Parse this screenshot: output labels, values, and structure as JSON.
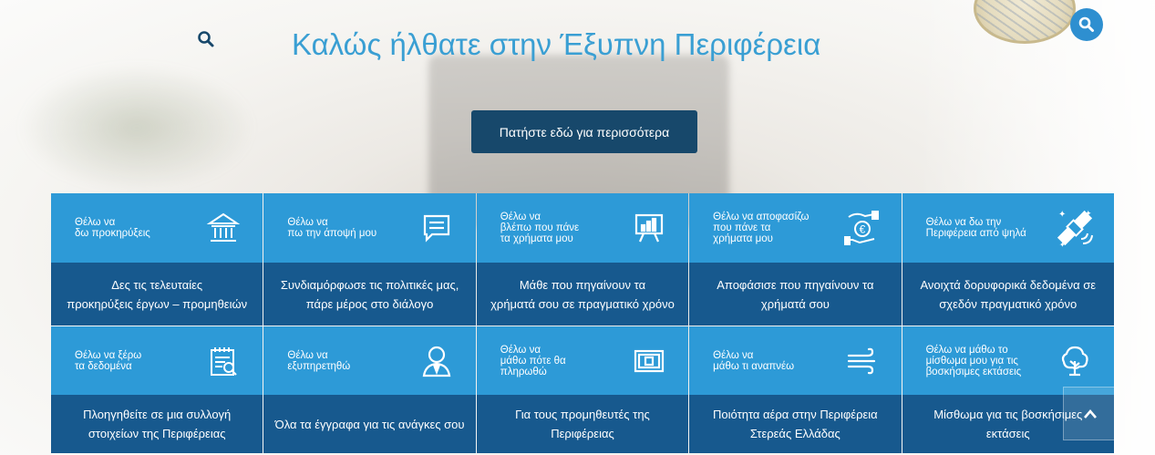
{
  "hero": {
    "title": "Καλώς ήλθατε στην Έξυπνη Περιφέρεια",
    "cta_label": "Πατήστε εδώ για περισσότερα"
  },
  "colors": {
    "title": "#3a9fd3",
    "cta_bg": "#17486b",
    "tile_top": "#2d9ad7",
    "tile_bottom": "#17598e"
  },
  "tiles_row1": [
    {
      "label": "Θέλω να\nδω προκηρύξεις",
      "desc": "Δες τις τελευταίες\nπροκηρύξεις έργων – προμηθειών",
      "icon": "bank-icon"
    },
    {
      "label": "Θέλω να\nπω την άποψή μου",
      "desc": "Συνδιαμόρφωσε τις πολιτικές μας,\nπάρε μέρος στο διάλογο",
      "icon": "chat-icon"
    },
    {
      "label": "Θέλω να\nβλέπω που πάνε\nτα χρήματα μου",
      "desc": "Μάθε που πηγαίνουν τα\nχρήματά σου σε πραγματικό χρόνο",
      "icon": "presentation-chart-icon"
    },
    {
      "label": "Θέλω να αποφασίζω\nπου πάνε τα\nχρήματα μου",
      "desc": "Αποφάσισε που πηγαίνουν τα\nχρήματά σου",
      "icon": "euro-hand-icon"
    },
    {
      "label": "Θέλω να δω την\nΠεριφέρεια από ψηλά",
      "desc": "Ανοιχτά δορυφορικά δεδομένα σε\nσχεδόν πραγματικό χρόνο",
      "icon": "satellite-icon"
    }
  ],
  "tiles_row2": [
    {
      "label": "Θέλω να ξέρω\nτα δεδομένα",
      "desc": "Πλοηγηθείτε σε μια συλλογή\nστοιχείων της Περιφέρειας",
      "icon": "data-calendar-icon"
    },
    {
      "label": "Θέλω να\nεξυπηρετηθώ",
      "desc": "Όλα τα έγγραφα για τις ανάγκες σου",
      "icon": "person-service-icon"
    },
    {
      "label": "Θέλω να\nμάθω πότε θα\nπληρωθώ",
      "desc": "Για τους προμηθευτές της\nΠεριφέρειας",
      "icon": "money-bill-icon"
    },
    {
      "label": "Θέλω να\nμάθω τι αναπνέω",
      "desc": "Ποιότητα αέρα στην Περιφέρεια\nΣτερεάς Ελλάδας",
      "icon": "wind-icon"
    },
    {
      "label": "Θέλω να μάθω το\nμίσθωμα μου για τις\nβοσκήσιμες εκτάσεις",
      "desc": "Μίσθωμα για τις βοσκήσιμες\nεκτάσεις",
      "icon": "tree-icon"
    }
  ]
}
